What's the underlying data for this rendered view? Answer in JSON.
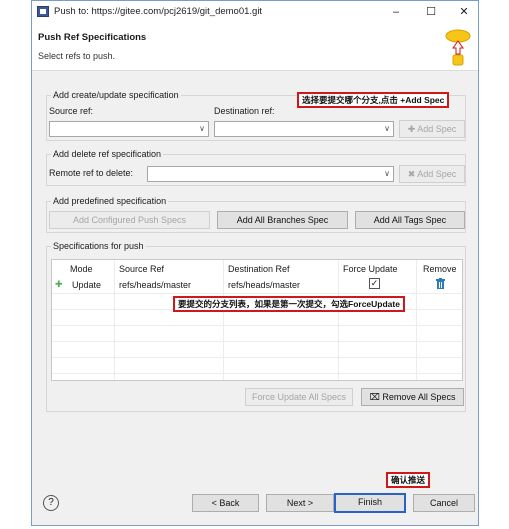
{
  "window": {
    "title": "Push to: https://gitee.com/pcj2619/git_demo01.git",
    "minimize": "–",
    "maximize": "☐",
    "close": "✕"
  },
  "header": {
    "title": "Push Ref Specifications",
    "subtitle": "Select refs to push."
  },
  "create_group": {
    "legend": "Add create/update specification",
    "source_label": "Source ref:",
    "destination_label": "Destination ref:",
    "source_value": "",
    "destination_value": "",
    "add_spec": "Add Spec"
  },
  "delete_group": {
    "legend": "Add delete ref specification",
    "remote_label": "Remote ref to delete:",
    "remote_value": "",
    "add_spec": "Add Spec"
  },
  "predefined_group": {
    "legend": "Add predefined specification",
    "configured": "Add Configured Push Specs",
    "all_branches": "Add All Branches Spec",
    "all_tags": "Add All Tags Spec"
  },
  "specs_group": {
    "legend": "Specifications for push",
    "columns": [
      "Mode",
      "Source Ref",
      "Destination Ref",
      "Force Update",
      "Remove"
    ],
    "rows": [
      {
        "mode": "Update",
        "source": "refs/heads/master",
        "destination": "refs/heads/master",
        "force_update": true
      }
    ],
    "force_update_all": "Force Update All Specs",
    "remove_all": "Remove All Specs"
  },
  "footer": {
    "help": "?",
    "back": "< Back",
    "next": "Next >",
    "finish": "Finish",
    "cancel": "Cancel"
  },
  "annotations": {
    "select_branch": "选择要提交哪个分支,点击 +Add Spec",
    "branch_list": "要提交的分支列表，如果是第一次提交，勾选ForceUpdate",
    "confirm_push": "确认推送"
  },
  "colors": {
    "annotation_border": "#d11717",
    "default_button_border": "#2a62c6",
    "add_icon": "#4caf50",
    "trash_icon": "#2b7bb9",
    "banner_yellow": "#f5c518"
  }
}
